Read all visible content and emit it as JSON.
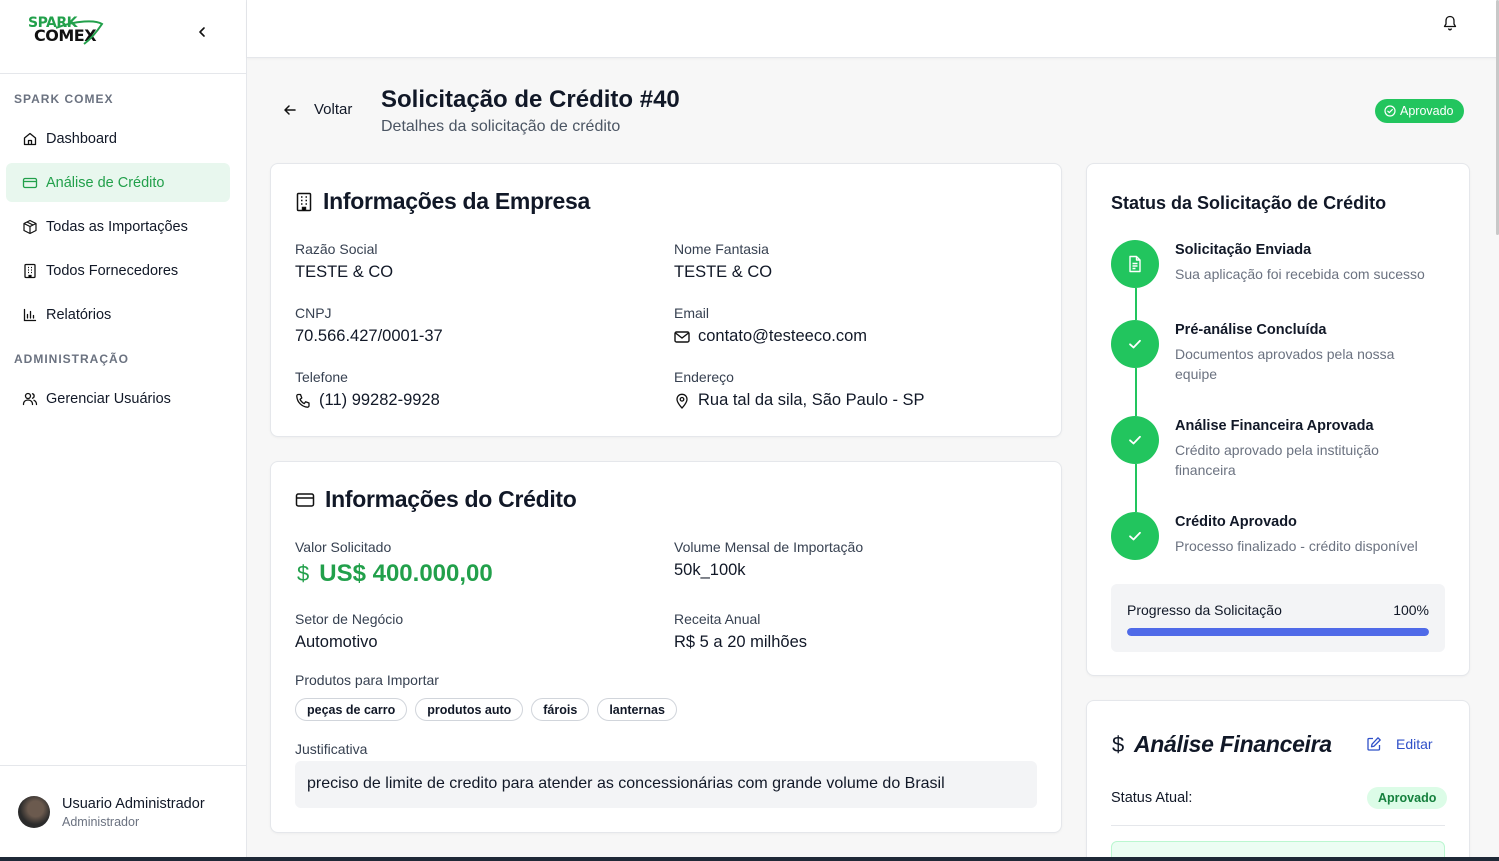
{
  "brand": {
    "line1": "SPARK",
    "line2": "COMEX",
    "green": "#22a04b"
  },
  "sidebar": {
    "section1": "SPARK COMEX",
    "items": [
      {
        "label": "Dashboard",
        "icon": "home-icon"
      },
      {
        "label": "Análise de Crédito",
        "icon": "credit-card-icon",
        "active": true
      },
      {
        "label": "Todas as Importações",
        "icon": "package-icon"
      },
      {
        "label": "Todos Fornecedores",
        "icon": "building-icon"
      },
      {
        "label": "Relatórios",
        "icon": "bar-chart-icon"
      }
    ],
    "section2": "ADMINISTRAÇÃO",
    "admin_items": [
      {
        "label": "Gerenciar Usuários",
        "icon": "users-icon"
      }
    ],
    "user": {
      "name": "Usuario Administrador",
      "role": "Administrador"
    }
  },
  "header": {
    "back_label": "Voltar",
    "title": "Solicitação de Crédito #40",
    "subtitle": "Detalhes da solicitação de crédito",
    "status_badge": "Aprovado"
  },
  "company": {
    "title": "Informações da Empresa",
    "razao_label": "Razão Social",
    "razao_value": "TESTE & CO",
    "fantasia_label": "Nome Fantasia",
    "fantasia_value": "TESTE & CO",
    "cnpj_label": "CNPJ",
    "cnpj_value": "70.566.427/0001-37",
    "email_label": "Email",
    "email_value": "contato@testeeco.com",
    "telefone_label": "Telefone",
    "telefone_value": "(11) 99282-9928",
    "endereco_label": "Endereço",
    "endereco_value": "Rua tal da sila, São Paulo - SP"
  },
  "credit": {
    "title": "Informações do Crédito",
    "valor_label": "Valor Solicitado",
    "valor_symbol": "$",
    "valor_value": "US$ 400.000,00",
    "volume_label": "Volume Mensal de Importação",
    "volume_value": "50k_100k",
    "setor_label": "Setor de Negócio",
    "setor_value": "Automotivo",
    "receita_label": "Receita Anual",
    "receita_value": "R$ 5 a 20 milhões",
    "produtos_label": "Produtos para Importar",
    "produtos": [
      "peças de carro",
      "produtos auto",
      "fárois",
      "lanternas"
    ],
    "justificativa_label": "Justificativa",
    "justificativa_value": "preciso de limite de credito para atender as concessionárias com grande volume do Brasil"
  },
  "status": {
    "title": "Status da Solicitação de Crédito",
    "steps": [
      {
        "title": "Solicitação Enviada",
        "desc": "Sua aplicação foi recebida com sucesso",
        "icon": "document-icon"
      },
      {
        "title": "Pré-análise Concluída",
        "desc": "Documentos aprovados pela nossa equipe",
        "icon": "check-icon"
      },
      {
        "title": "Análise Financeira Aprovada",
        "desc": "Crédito aprovado pela instituição financeira",
        "icon": "check-icon"
      },
      {
        "title": "Crédito Aprovado",
        "desc": "Processo finalizado - crédito disponível",
        "icon": "check-icon"
      }
    ],
    "progress_label": "Progresso da Solicitação",
    "progress_text": "100%",
    "progress_value": 1.0
  },
  "financial": {
    "symbol": "$",
    "title": "Análise Financeira",
    "edit_label": "Editar",
    "status_label": "Status Atual:",
    "status_value": "Aprovado"
  },
  "colors": {
    "success": "#22c55e",
    "progress": "#4f6ae8",
    "link": "#2f50c8"
  }
}
